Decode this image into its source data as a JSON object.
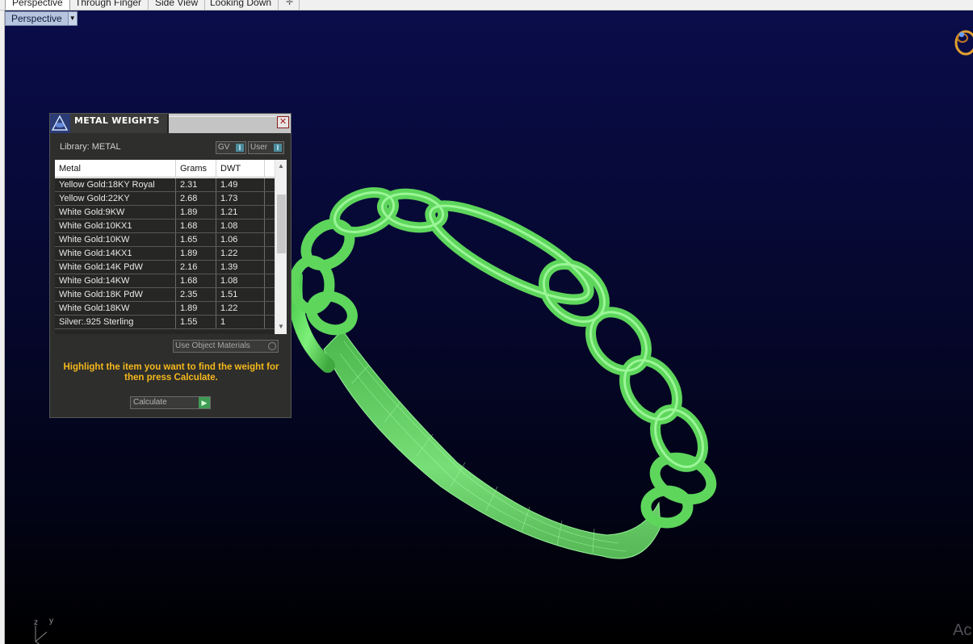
{
  "tabs": [
    {
      "label": "Perspective",
      "active": true
    },
    {
      "label": "Through Finger",
      "active": false
    },
    {
      "label": "Side View",
      "active": false
    },
    {
      "label": "Looking Down",
      "active": false
    }
  ],
  "add_tab_icon": "plus-icon",
  "viewport": {
    "label": "Perspective",
    "axes": {
      "z": "z",
      "y": "y"
    },
    "watermark": "Ac"
  },
  "panel": {
    "title": "METAL WEIGHTS",
    "library": "Library: METAL",
    "buttons": {
      "gv": "GV",
      "user": "User"
    },
    "columns": [
      "Metal",
      "Grams",
      "DWT"
    ],
    "rows": [
      {
        "metal": "Yellow Gold:18KY Royal",
        "grams": "2.31",
        "dwt": "1.49"
      },
      {
        "metal": "Yellow Gold:22KY",
        "grams": "2.68",
        "dwt": "1.73"
      },
      {
        "metal": "White Gold:9KW",
        "grams": "1.89",
        "dwt": "1.21"
      },
      {
        "metal": "White Gold:10KX1",
        "grams": "1.68",
        "dwt": "1.08"
      },
      {
        "metal": "White Gold:10KW",
        "grams": "1.65",
        "dwt": "1.06"
      },
      {
        "metal": "White Gold:14KX1",
        "grams": "1.89",
        "dwt": "1.22"
      },
      {
        "metal": "White Gold:14K PdW",
        "grams": "2.16",
        "dwt": "1.39"
      },
      {
        "metal": "White Gold:14KW",
        "grams": "1.68",
        "dwt": "1.08"
      },
      {
        "metal": "White Gold:18K PdW",
        "grams": "2.35",
        "dwt": "1.51"
      },
      {
        "metal": "White Gold:18KW",
        "grams": "1.89",
        "dwt": "1.22"
      },
      {
        "metal": "Silver:.925 Sterling",
        "grams": "1.55",
        "dwt": "1"
      }
    ],
    "use_object_materials": "Use Object Materials",
    "hint": "Highlight the item you want to find the weight for then press Calculate.",
    "calculate": "Calculate"
  },
  "colors": {
    "viewport_top": "#0a0d4a",
    "ring_green": "#6fe86f",
    "hint_orange": "#f5b81c",
    "panel_bg": "#2e2e2c"
  }
}
